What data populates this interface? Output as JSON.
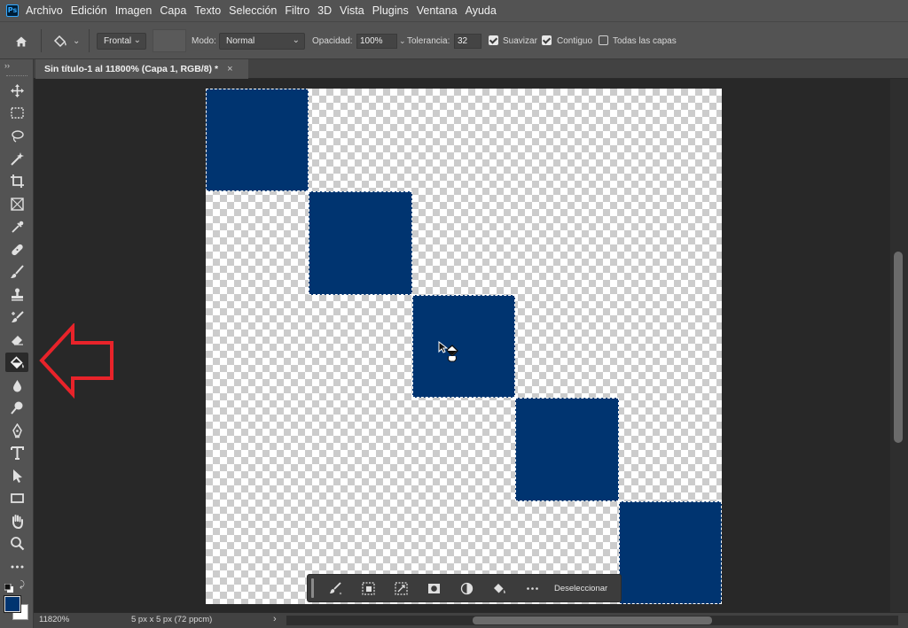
{
  "app": {
    "logo": "Ps",
    "menu": [
      "Archivo",
      "Edición",
      "Imagen",
      "Capa",
      "Texto",
      "Selección",
      "Filtro",
      "3D",
      "Vista",
      "Plugins",
      "Ventana",
      "Ayuda"
    ]
  },
  "options_bar": {
    "home_icon": "home-icon",
    "tool_preset_icon": "paint-bucket-icon",
    "source_value": "Frontal",
    "mode_label": "Modo:",
    "mode_value": "Normal",
    "opacity_label": "Opacidad:",
    "opacity_value": "100%",
    "tolerance_label": "Tolerancia:",
    "tolerance_value": "32",
    "antialias_label": "Suavizar",
    "antialias_checked": true,
    "contiguous_label": "Contiguo",
    "contiguous_checked": true,
    "all_layers_label": "Todas las capas",
    "all_layers_checked": false
  },
  "toolbar": {
    "collapse": "››",
    "tools": [
      {
        "name": "move-tool",
        "icon": "move-icon"
      },
      {
        "name": "marquee-tool",
        "icon": "rect-marquee-icon"
      },
      {
        "name": "lasso-tool",
        "icon": "lasso-icon"
      },
      {
        "name": "magic-wand-tool",
        "icon": "magic-wand-icon"
      },
      {
        "name": "crop-tool",
        "icon": "crop-icon"
      },
      {
        "name": "frame-tool",
        "icon": "frame-icon"
      },
      {
        "name": "eyedropper-tool",
        "icon": "eyedropper-icon"
      },
      {
        "name": "healing-tool",
        "icon": "bandage-icon"
      },
      {
        "name": "brush-tool",
        "icon": "brush-icon"
      },
      {
        "name": "stamp-tool",
        "icon": "stamp-icon"
      },
      {
        "name": "history-brush-tool",
        "icon": "history-brush-icon"
      },
      {
        "name": "eraser-tool",
        "icon": "eraser-icon"
      },
      {
        "name": "paint-bucket-tool",
        "icon": "paint-bucket-icon",
        "active": true
      },
      {
        "name": "blur-tool",
        "icon": "drop-icon"
      },
      {
        "name": "dodge-tool",
        "icon": "dodge-icon"
      },
      {
        "name": "pen-tool",
        "icon": "pen-icon"
      },
      {
        "name": "type-tool",
        "icon": "type-icon"
      },
      {
        "name": "path-select-tool",
        "icon": "arrow-select-icon"
      },
      {
        "name": "shape-tool",
        "icon": "rectangle-icon"
      },
      {
        "name": "hand-tool",
        "icon": "hand-icon"
      },
      {
        "name": "zoom-tool",
        "icon": "zoom-icon"
      },
      {
        "name": "more-tools",
        "icon": "ellipsis-icon"
      }
    ],
    "foreground_color": "#003470",
    "background_color": "#ffffff"
  },
  "document": {
    "tab_title": "Sin título-1 al 11800% (Capa 1, RGB/8) *",
    "close": "×",
    "fill_color": "#003470",
    "grid_size": 5,
    "filled_cells": [
      [
        0,
        0
      ],
      [
        1,
        1
      ],
      [
        2,
        2
      ],
      [
        3,
        3
      ],
      [
        4,
        4
      ]
    ]
  },
  "taskbar": {
    "buttons": [
      "brush-select-icon",
      "select-subject-icon",
      "transform-selection-icon",
      "mask-icon",
      "adjustment-icon",
      "fill-icon",
      "more-icon"
    ],
    "deselect_label": "Deseleccionar"
  },
  "status": {
    "zoom": "11820%",
    "doc_info": "5 px x 5 px (72 ppcm)",
    "arrow": "›"
  },
  "annotation": {
    "color": "#e8232a"
  }
}
